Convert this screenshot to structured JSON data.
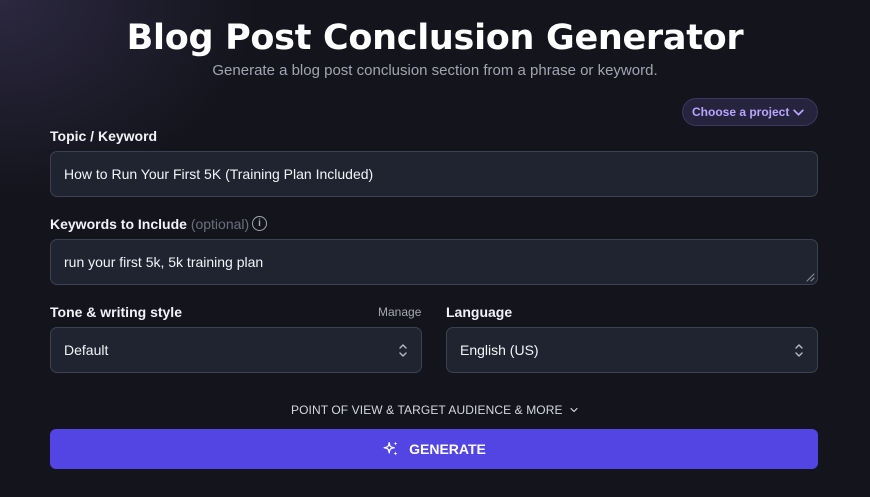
{
  "header": {
    "title": "Blog Post Conclusion Generator",
    "subtitle": "Generate a blog post conclusion section from a phrase or keyword."
  },
  "project": {
    "label": "Choose a project",
    "icon": "chevron-down-icon"
  },
  "topic": {
    "label": "Topic / Keyword",
    "value": "How to Run Your First 5K (Training Plan Included)"
  },
  "keywords": {
    "label": "Keywords to Include",
    "optional": "(optional)",
    "info_icon": "i",
    "value": "run your first 5k, 5k training plan"
  },
  "tone": {
    "label": "Tone & writing style",
    "manage": "Manage",
    "value": "Default"
  },
  "language": {
    "label": "Language",
    "value": "English (US)"
  },
  "more_options": {
    "label": "POINT OF VIEW & TARGET AUDIENCE & MORE"
  },
  "generate": {
    "label": "GENERATE",
    "icon": "sparkle-icon"
  },
  "colors": {
    "background": "#13141c",
    "field_bg": "#1f2430",
    "accent": "#5245e4",
    "project_text": "#b9a5ff"
  }
}
